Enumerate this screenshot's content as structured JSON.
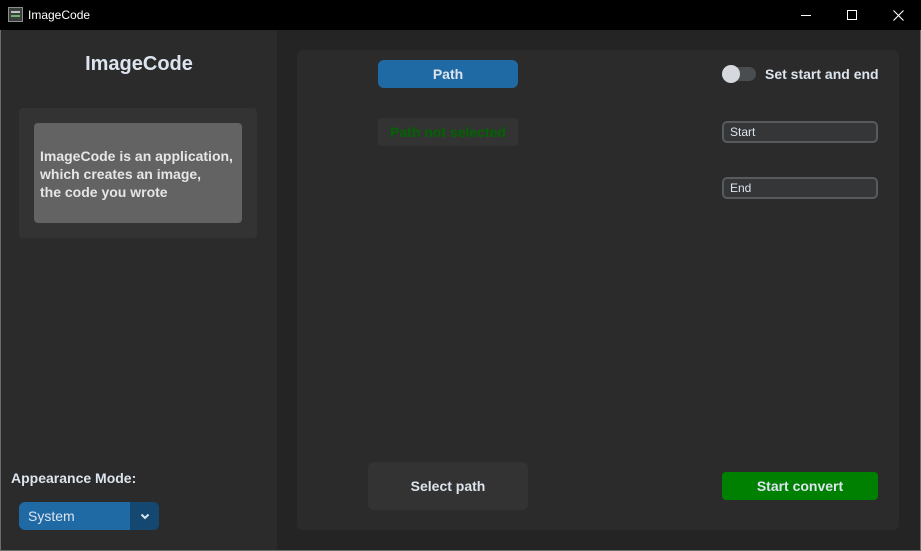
{
  "window": {
    "title": "ImageCode",
    "icon": "app-icon",
    "controls": [
      "minimize-icon",
      "maximize-icon",
      "close-icon"
    ]
  },
  "sidebar": {
    "title": "ImageCode",
    "info_lines": [
      "ImageCode is an application,",
      "which creates an image,",
      "the code you wrote"
    ],
    "appearance_label": "Appearance Mode:",
    "appearance_value": "System"
  },
  "main": {
    "path_button": "Path",
    "path_status": "Path not selected",
    "switch_label": "Set start and end",
    "switch_on": false,
    "start_placeholder": "Start",
    "end_placeholder": "End",
    "select_path_button": "Select path",
    "start_convert_button": "Start convert"
  },
  "colors": {
    "accent": "#1f6aa5",
    "status_text": "#006400",
    "convert": "#008000"
  }
}
